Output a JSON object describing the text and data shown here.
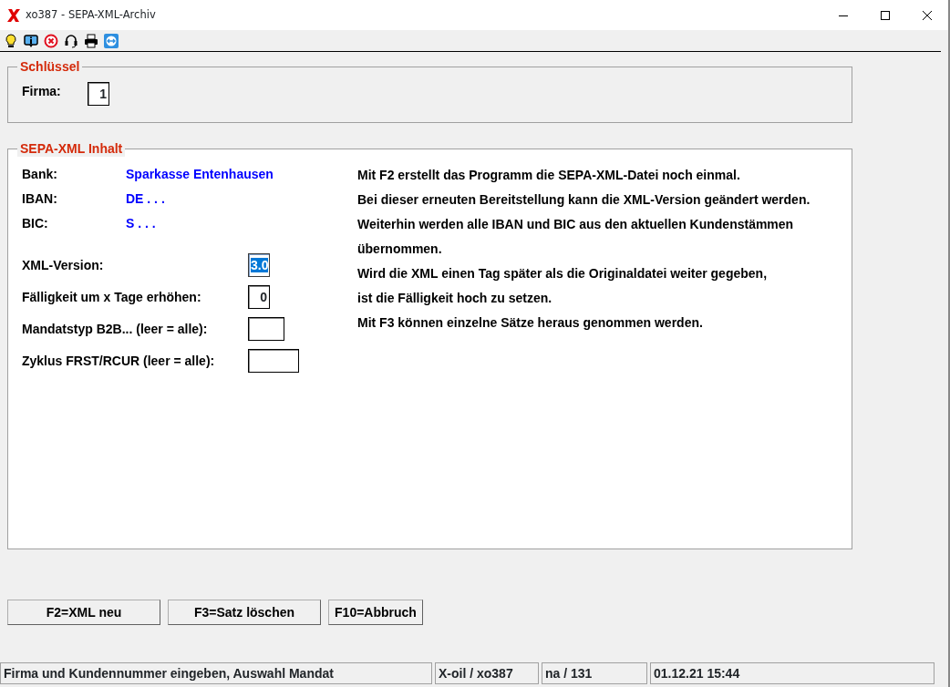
{
  "window": {
    "title": "xo387 - SEPA-XML-Archiv"
  },
  "toolbar": {
    "icons": [
      {
        "kind": "bulb"
      },
      {
        "kind": "info"
      },
      {
        "kind": "cancel"
      },
      {
        "kind": "headset"
      },
      {
        "kind": "print"
      },
      {
        "kind": "remote"
      }
    ]
  },
  "key_group": {
    "title": "Schlüssel",
    "fields": [
      {
        "label": "Firma:",
        "value": "1"
      }
    ]
  },
  "content_group": {
    "title": "SEPA-XML Inhalt",
    "info": [
      {
        "label": "Bank:",
        "value": "Sparkasse Entenhausen"
      },
      {
        "label": "IBAN:",
        "value": "DE . . ."
      },
      {
        "label": "BIC:",
        "value": "S . . ."
      }
    ],
    "fields": [
      {
        "label": "XML-Version:",
        "value": "3.0",
        "selected": true
      },
      {
        "label": "Fälligkeit um x Tage erhöhen:",
        "value": "0",
        "selected": false
      },
      {
        "label": "Mandatstyp B2B... (leer = alle):",
        "selected": false
      },
      {
        "label": "Zyklus FRST/RCUR (leer = alle):",
        "selected": false
      }
    ],
    "notes": [
      "Mit F2 erstellt das Programm die SEPA-XML-Datei noch einmal.",
      "Bei dieser erneuten Bereitstellung kann die XML-Version geändert werden.",
      "Weiterhin werden alle IBAN und BIC aus den aktuellen Kundenstämmen",
      "übernommen.",
      "Wird die XML einen Tag später als die Originaldatei weiter gegeben,",
      "ist die Fälligkeit hoch zu setzen.",
      "Mit F3 können einzelne Sätze heraus genommen werden."
    ]
  },
  "buttons": [
    {
      "label": "F2=XML neu"
    },
    {
      "label": "F3=Satz löschen"
    },
    {
      "label": "F10=Abbruch"
    }
  ],
  "status_bar": [
    "Firma und Kundennummer eingeben, Auswahl Mandat",
    "X-oil / xo387",
    "na / 131",
    "01.12.21 15:44"
  ]
}
